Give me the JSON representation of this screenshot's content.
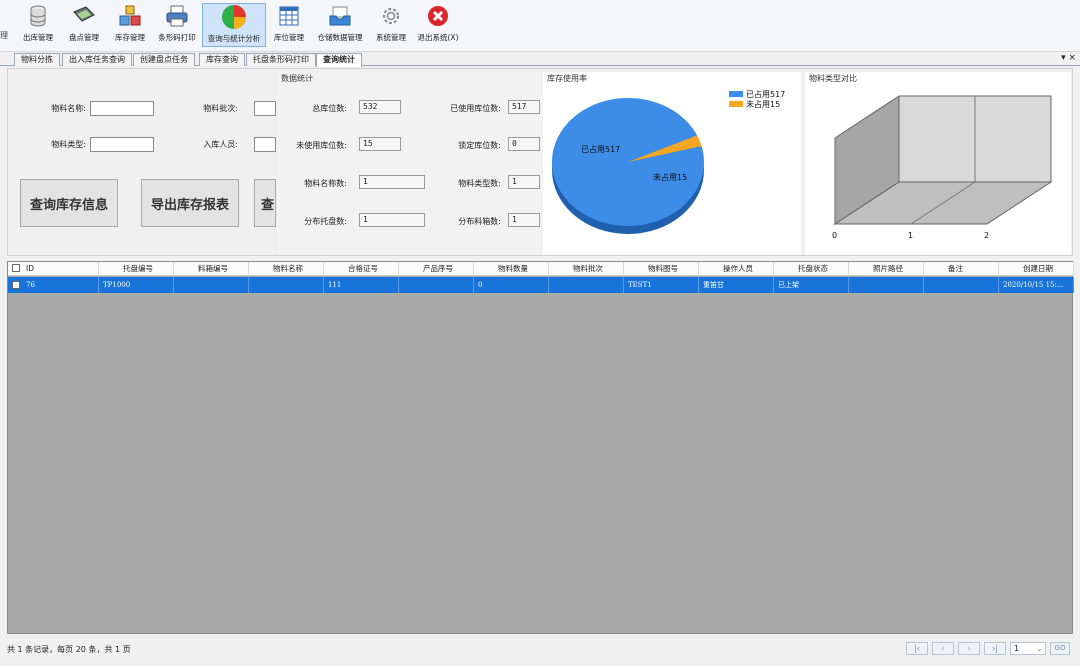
{
  "toolbar": {
    "edge_label": "理",
    "buttons": [
      {
        "label": "出库管理",
        "icon": "database-icon"
      },
      {
        "label": "盘点管理",
        "icon": "scanner-icon"
      },
      {
        "label": "库存管理",
        "icon": "boxes-icon"
      },
      {
        "label": "条形码打印",
        "icon": "printer-icon"
      },
      {
        "label": "查询与统计分析",
        "icon": "pie-chart-icon"
      },
      {
        "label": "库位管理",
        "icon": "grid-calendar-icon"
      },
      {
        "label": "仓储数据管理",
        "icon": "inbox-tray-icon"
      },
      {
        "label": "系统管理",
        "icon": "gear-icon"
      },
      {
        "label": "退出系统(X)",
        "icon": "exit-x-icon"
      }
    ]
  },
  "tabs": [
    "物料分拣",
    "出入库任务查询",
    "创建盘点任务",
    "库存查询",
    "托盘条形码打印",
    "查询统计"
  ],
  "tab_controls": "▾ ×",
  "query": {
    "material_name_label": "物料名称:",
    "material_batch_label": "物料批次:",
    "material_type_label": "物料类型:",
    "inbound_person_label": "入库人员:",
    "query_button": "查询库存信息",
    "export_button": "导出库存报表",
    "third_button": "查"
  },
  "stats": {
    "title": "数据统计",
    "total_label": "总库位数:",
    "total_value": "532",
    "used_label": "已使用库位数:",
    "used_value": "517",
    "unused_label": "未使用库位数:",
    "unused_value": "15",
    "locked_label": "锁定库位数:",
    "locked_value": "0",
    "mat_name_count_label": "物料名称数:",
    "mat_name_count_value": "1",
    "mat_type_count_label": "物料类型数:",
    "mat_type_count_value": "1",
    "pallet_count_label": "分布托盘数:",
    "pallet_count_value": "1",
    "box_count_label": "分布料箱数:",
    "box_count_value": "1"
  },
  "chart_data": [
    {
      "type": "pie",
      "title": "库存使用率",
      "categories": [
        "已占用517",
        "未占用15"
      ],
      "values": [
        517,
        15
      ],
      "slice_labels": [
        "已占用517",
        "未占用15"
      ],
      "colors": [
        "#3d8de8",
        "#f5a623"
      ],
      "legend": "top-right"
    },
    {
      "type": "bar",
      "title": "物料类型对比",
      "x_ticks": [
        "0",
        "1",
        "2"
      ],
      "categories": [],
      "values": []
    }
  ],
  "grid": {
    "columns": [
      "ID",
      "托盘编号",
      "料箱编号",
      "物料名称",
      "合格证号",
      "产品序号",
      "物料数量",
      "物料批次",
      "物料图号",
      "操作人员",
      "托盘状态",
      "照片路径",
      "备注",
      "创建日期"
    ],
    "rows": [
      [
        "76",
        "TP1000",
        "",
        "",
        "111",
        "",
        "0",
        "",
        "TEST1",
        "重笛甘",
        "已上架",
        "",
        "",
        "2020/10/15 15:..."
      ]
    ]
  },
  "footer": {
    "summary": "共 1 条记录，每页 20 条，共 1 页",
    "page_value": "1",
    "go_label": "GO"
  }
}
